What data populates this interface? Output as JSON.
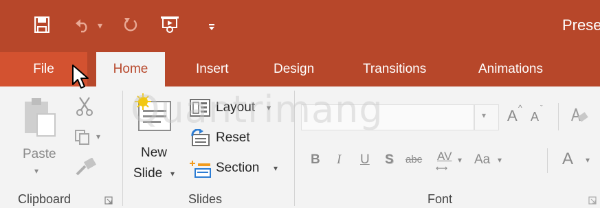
{
  "title_bar": {
    "document_title": "Presen",
    "quick_access": [
      {
        "name": "save-icon",
        "glyph": "🖫"
      },
      {
        "name": "undo-icon",
        "glyph": "↶"
      },
      {
        "name": "redo-icon",
        "glyph": "↻"
      },
      {
        "name": "present-from-start-icon",
        "glyph": "▶"
      },
      {
        "name": "customize-qat-icon",
        "glyph": "▾"
      }
    ]
  },
  "tabs": {
    "file": "File",
    "home": "Home",
    "insert": "Insert",
    "design": "Design",
    "transitions": "Transitions",
    "animations": "Animations"
  },
  "ribbon": {
    "clipboard": {
      "group_label": "Clipboard",
      "paste_label": "Paste"
    },
    "slides": {
      "group_label": "Slides",
      "new_slide_line1": "New",
      "new_slide_line2": "Slide",
      "layout_label": "Layout",
      "reset_label": "Reset",
      "section_label": "Section"
    },
    "font": {
      "group_label": "Font",
      "bold": "B",
      "italic": "I",
      "underline": "U",
      "shadow": "S",
      "strikethrough": "abc",
      "char_spacing": "AV",
      "change_case": "Aa",
      "font_color": "A",
      "grow_font": "A",
      "shrink_font": "A"
    }
  },
  "watermark": "Quantrimang",
  "colors": {
    "accent": "#b7472a",
    "file_tab": "#d35230",
    "ribbon_bg": "#f3f3f3"
  }
}
